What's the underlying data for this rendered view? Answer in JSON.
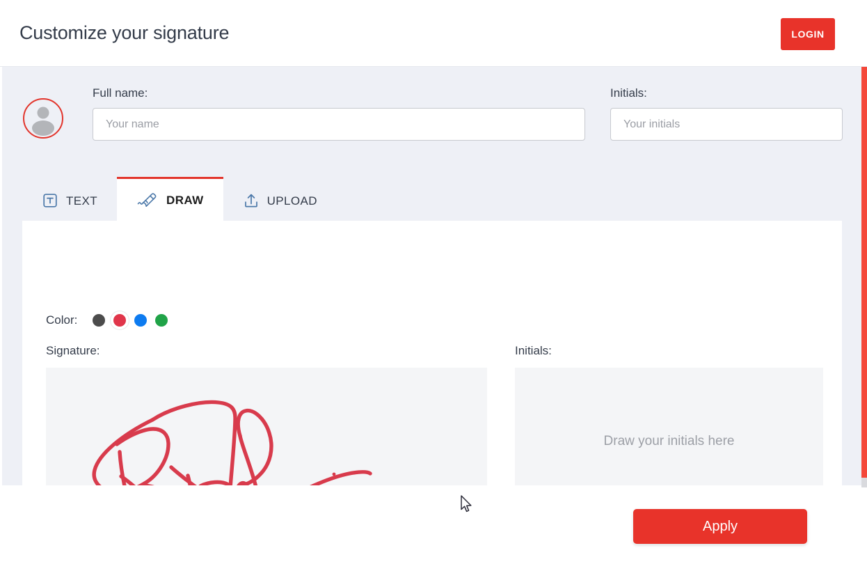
{
  "header": {
    "title": "Customize your signature",
    "login_label": "LOGIN"
  },
  "form": {
    "fullname": {
      "label": "Full name:",
      "value": "",
      "placeholder": "Your name"
    },
    "initials": {
      "label": "Initials:",
      "value": "",
      "placeholder": "Your initials"
    }
  },
  "tabs": [
    {
      "id": "text",
      "label": "TEXT",
      "icon": "text-box-icon",
      "active": false
    },
    {
      "id": "draw",
      "label": "DRAW",
      "icon": "pen-nib-icon",
      "active": true
    },
    {
      "id": "upload",
      "label": "UPLOAD",
      "icon": "upload-icon",
      "active": false
    }
  ],
  "draw_panel": {
    "color_label": "Color:",
    "colors": [
      {
        "name": "dark-gray",
        "hex": "#4c4c4c",
        "selected": false
      },
      {
        "name": "red",
        "hex": "#e0354a",
        "selected": true
      },
      {
        "name": "blue",
        "hex": "#0d7bf0",
        "selected": false
      },
      {
        "name": "green",
        "hex": "#20a348",
        "selected": false
      }
    ],
    "signature": {
      "label": "Signature:",
      "has_drawing": true,
      "stroke_color": "#d83b4c",
      "placeholder": ""
    },
    "initials": {
      "label": "Initials:",
      "has_drawing": false,
      "stroke_color": "#d83b4c",
      "placeholder": "Draw your initials here"
    }
  },
  "footer": {
    "apply_label": "Apply"
  },
  "theme": {
    "accent": "#e8332a",
    "scrollbar_thumb": "#f4483a",
    "body_background": "#eef0f6",
    "icon_blue": "#4a77a8",
    "title_color": "#333b49"
  }
}
